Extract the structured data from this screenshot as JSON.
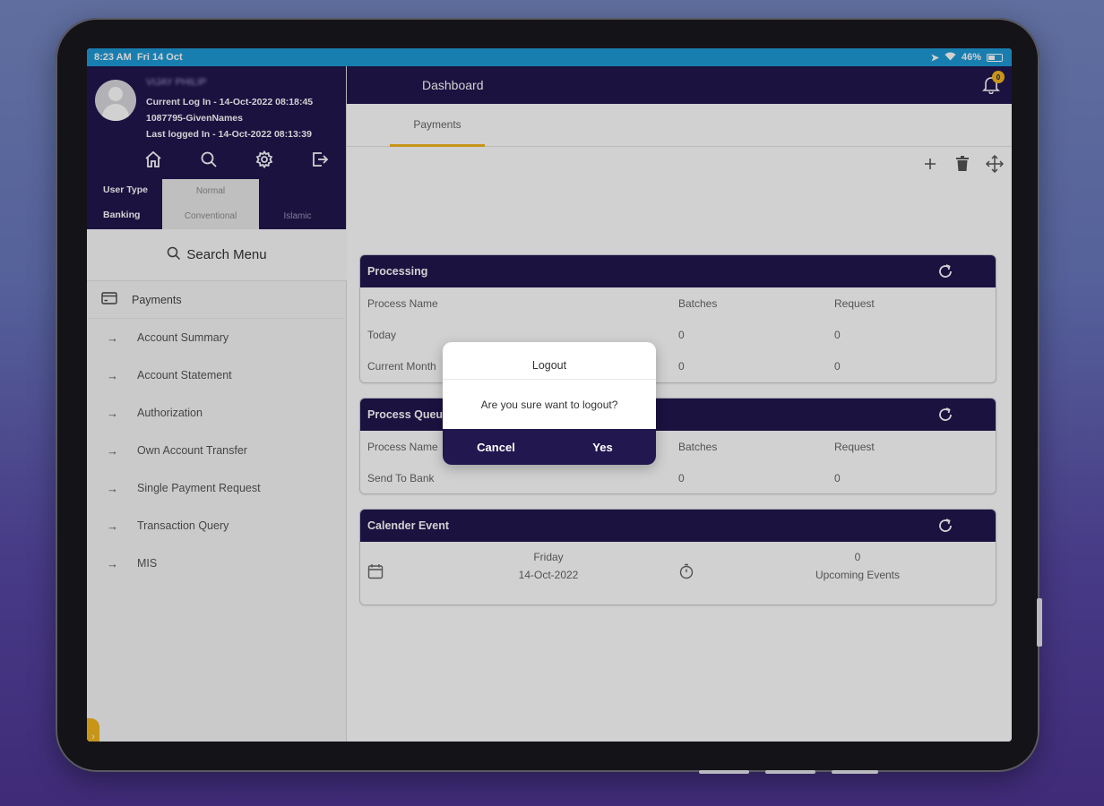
{
  "status_bar": {
    "time": "8:23 AM",
    "date": "Fri 14 Oct",
    "battery": "46%"
  },
  "profile": {
    "name": "VIJAY PHILIP",
    "current_login": "Current Log In - 14-Oct-2022 08:18:45",
    "user_id": "1087795-GivenNames",
    "last_login": "Last logged In - 14-Oct-2022 08:13:39",
    "icons": [
      "home-icon",
      "search-icon",
      "settings-icon",
      "logout-icon"
    ],
    "user_type_label": "User Type",
    "user_type_value": "Normal",
    "banking_label": "Banking",
    "banking_options": [
      "Conventional",
      "Islamic"
    ],
    "banking_selected": "Conventional"
  },
  "sidebar": {
    "search_label": "Search Menu",
    "group_label": "Payments",
    "items": [
      {
        "label": "Account Summary"
      },
      {
        "label": "Account Statement"
      },
      {
        "label": "Authorization"
      },
      {
        "label": "Own Account Transfer"
      },
      {
        "label": "Single Payment Request"
      },
      {
        "label": "Transaction Query"
      },
      {
        "label": "MIS"
      }
    ]
  },
  "header": {
    "title": "Dashboard",
    "notification_count": "0"
  },
  "tabs": [
    {
      "label": "Payments",
      "active": true
    }
  ],
  "cards": {
    "processing": {
      "title": "Processing",
      "columns": [
        "Process Name",
        "Batches",
        "Request"
      ],
      "rows": [
        [
          "Today",
          "0",
          "0"
        ],
        [
          "Current Month",
          "0",
          "0"
        ]
      ]
    },
    "process_queue": {
      "title": "Process Queue",
      "columns": [
        "Process Name",
        "Batches",
        "Request"
      ],
      "rows": [
        [
          "Send To Bank",
          "0",
          "0"
        ]
      ]
    },
    "calendar": {
      "title": "Calender Event",
      "day": "Friday",
      "date": "14-Oct-2022",
      "upcoming_count": "0",
      "upcoming_label": "Upcoming Events"
    }
  },
  "dialog": {
    "title": "Logout",
    "message": "Are you sure want to logout?",
    "cancel_label": "Cancel",
    "confirm_label": "Yes"
  },
  "colors": {
    "primary": "#22174f",
    "accent": "#f3b81e",
    "status_bar": "#1e9ad6"
  }
}
